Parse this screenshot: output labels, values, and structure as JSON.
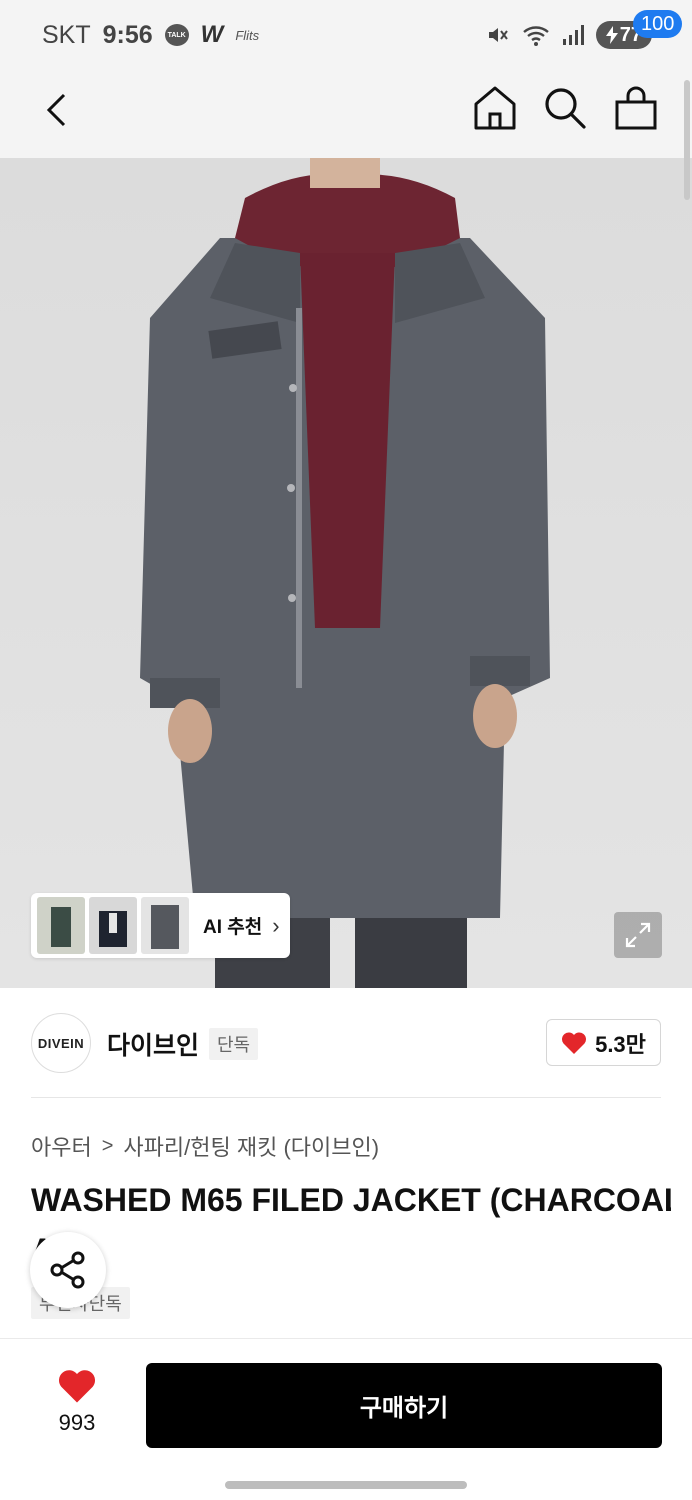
{
  "status_bar": {
    "carrier": "SKT",
    "time": "9:56",
    "talk_icon_text": "TALK",
    "w_icon_text": "W",
    "small_app_text": "Flits",
    "battery_level": "77"
  },
  "header": {
    "cart_count": "100"
  },
  "product_image": {
    "ai_label": "AI 추천",
    "ai_chevron": "›"
  },
  "brand": {
    "logo_text": "DIVEIN",
    "name": "다이브인",
    "exclusive_tag": "단독",
    "like_count": "5.3만"
  },
  "breadcrumb": {
    "category": "아우터",
    "separator": ">",
    "subcategory": "사파리/헌팅 재킷 (다이브인)"
  },
  "product": {
    "title": "WASHED M65 FILED JACKET (CHARCOAL)",
    "title_second_line": "AL)",
    "sub_tag": "무신사단독"
  },
  "bottom_bar": {
    "wish_count": "993",
    "buy_label": "구매하기"
  },
  "colors": {
    "accent_blue": "#1e7bf0",
    "heart_red": "#e3262a",
    "buy_button": "#000000"
  },
  "icons": [
    "back-arrow-icon",
    "home-icon",
    "search-icon",
    "cart-icon",
    "expand-icon",
    "share-icon",
    "heart-icon"
  ]
}
